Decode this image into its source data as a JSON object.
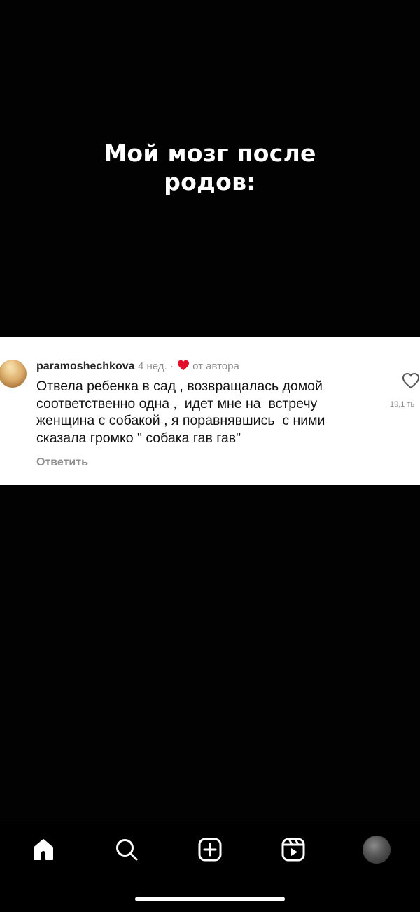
{
  "video": {
    "title_lines": [
      "Мой мозг после",
      "родов:"
    ]
  },
  "comment": {
    "username": "paramoshechkova",
    "time_ago": "4 нед.",
    "separator": "·",
    "author_like_label": "от автора",
    "text_lines": [
      "Отвела ребенка в сад , возвращалась домой",
      "соответственно одна ,  идет мне на  встречу",
      "женщина с собакой , я поравнявшись  с ними",
      "сказала громко \" собака гав гав\""
    ],
    "reply_label": "Ответить",
    "like_count": "19,1 ть"
  },
  "tab_bar": {
    "items": [
      {
        "name": "home",
        "icon": "home-icon"
      },
      {
        "name": "search",
        "icon": "search-icon"
      },
      {
        "name": "create",
        "icon": "plus-square-icon"
      },
      {
        "name": "reels",
        "icon": "reels-icon"
      },
      {
        "name": "profile",
        "icon": "profile-avatar"
      }
    ]
  },
  "colors": {
    "background": "#000000",
    "card": "#ffffff",
    "heart": "#e0102a",
    "muted": "#8e8e8e"
  }
}
